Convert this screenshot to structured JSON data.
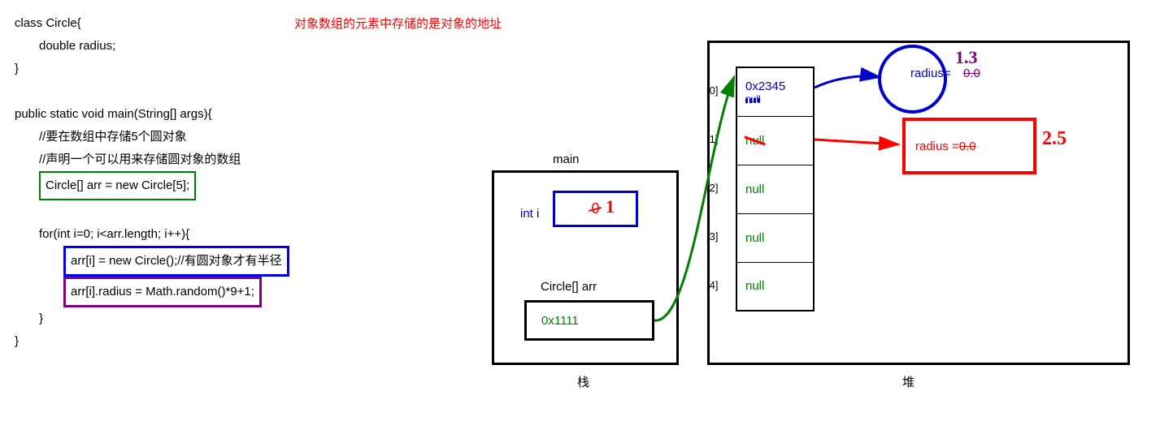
{
  "title": "对象数组的元素中存储的是对象的地址",
  "code": {
    "l1": "class Circle{",
    "l2": "double radius;",
    "l3": "}",
    "l4": "public static void main(String[] args){",
    "l5": "//要在数组中存储5个圆对象",
    "l6": "//声明一个可以用来存储圆对象的数组",
    "l7": "Circle[] arr = new Circle[5];",
    "l8": "for(int i=0; i<arr.length; i++){",
    "l9": "arr[i] = new Circle();//有圆对象才有半径",
    "l10": "arr[i].radius = Math.random()*9+1;",
    "l11": "}",
    "l12": "}"
  },
  "stack": {
    "title": "main",
    "var1_label": "int i",
    "var1_old": "0",
    "var1_new": "1",
    "var2_label": "Circle[]   arr",
    "var2_value": "0x1111",
    "footer": "栈"
  },
  "heap": {
    "footer": "堆",
    "array": {
      "indices": [
        "[0]",
        "[1]",
        "[2]",
        "[3]",
        "[4]"
      ],
      "cell0_addr": "0x2345",
      "cell0_old": "null",
      "cell1": "null",
      "cell2": "null",
      "cell3": "null",
      "cell4": "null"
    },
    "circle_obj": {
      "label": "radius=",
      "old": "0.0",
      "new": "1.3"
    },
    "red_obj": {
      "label": "radius = ",
      "old": "0.0",
      "new": "2.5"
    }
  }
}
